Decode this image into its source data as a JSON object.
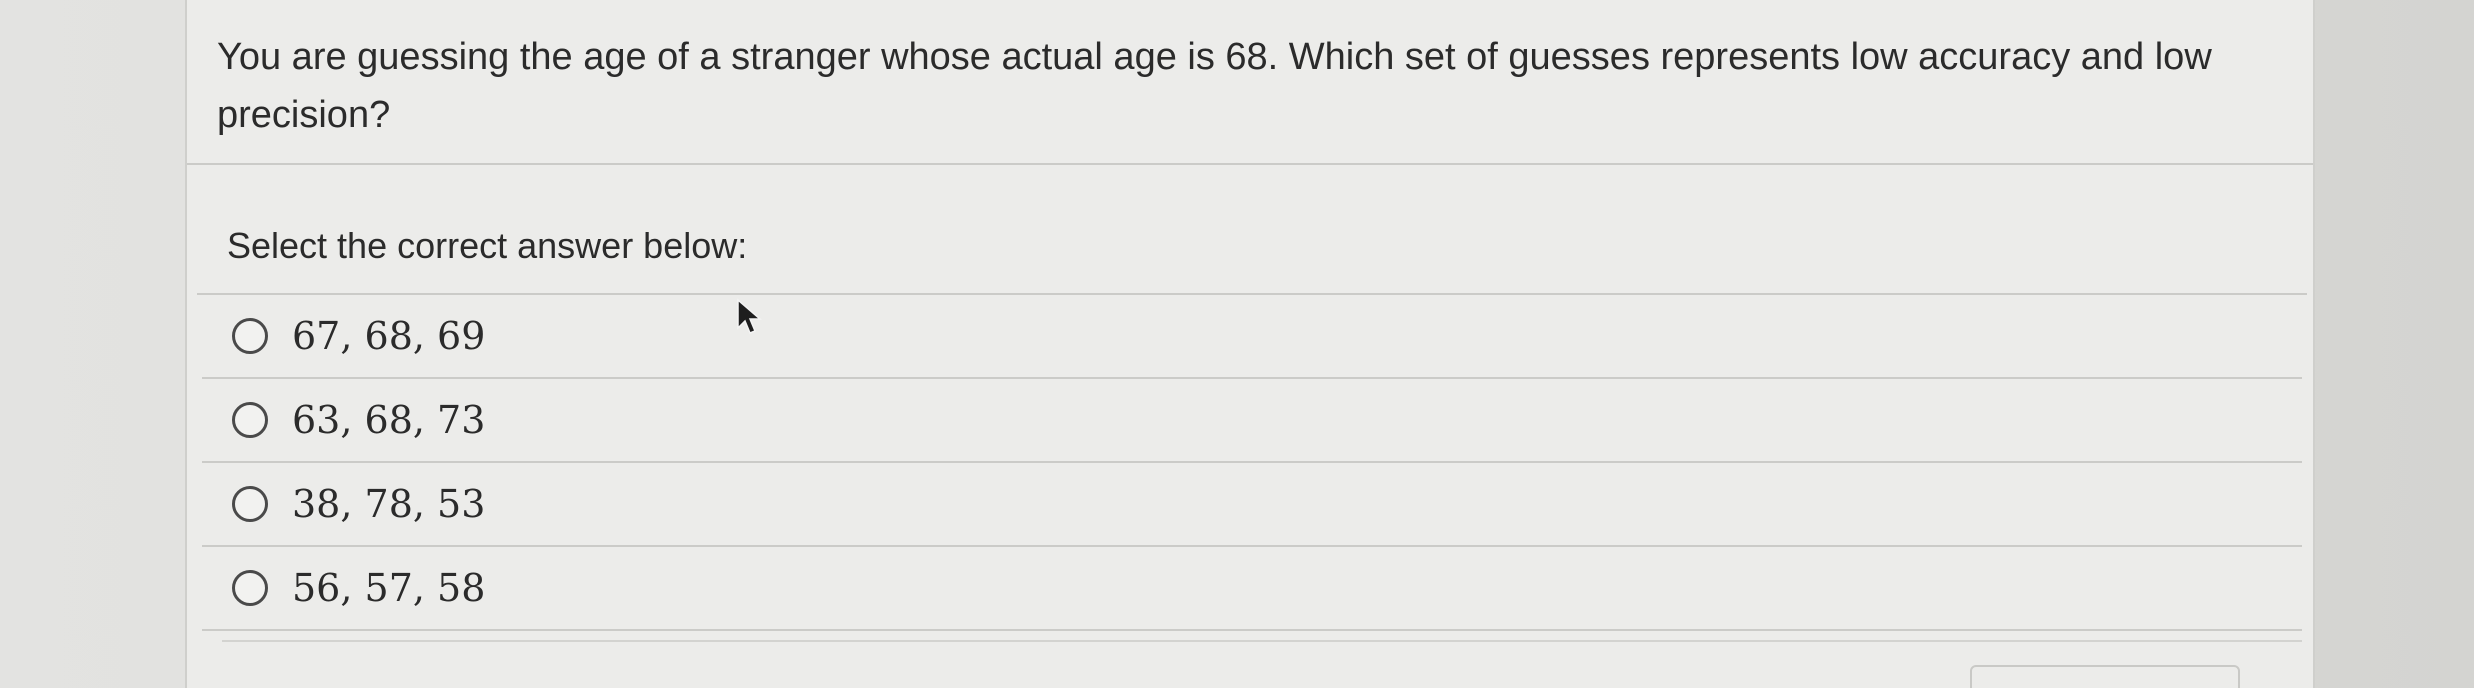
{
  "question": {
    "text": "You are guessing the age of a stranger whose actual age is 68. Which set of guesses represents low accuracy and low precision?"
  },
  "prompt": {
    "text": "Select the correct answer below:"
  },
  "options": [
    {
      "label": "67, 68, 69"
    },
    {
      "label": "63, 68, 73"
    },
    {
      "label": "38, 78, 53"
    },
    {
      "label": "56, 57, 58"
    }
  ]
}
